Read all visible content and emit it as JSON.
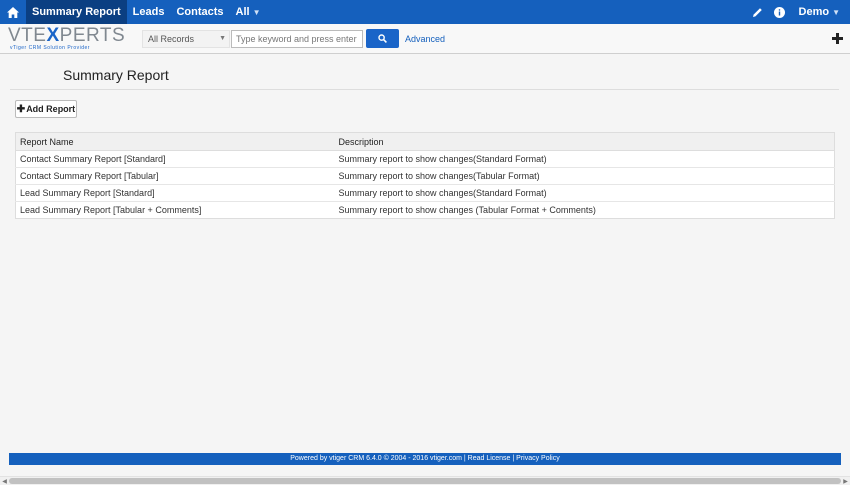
{
  "nav": {
    "items": [
      {
        "label": "Summary Report",
        "active": true
      },
      {
        "label": "Leads",
        "active": false
      },
      {
        "label": "Contacts",
        "active": false
      }
    ],
    "all_label": "All",
    "user_label": "Demo",
    "accent_color": "#1560bd"
  },
  "header": {
    "logo_main_a": "VTE",
    "logo_main_x": "X",
    "logo_main_b": "PERTS",
    "logo_sub": "vTiger CRM Solution Provider",
    "records_select": "All Records",
    "search_placeholder": "Type keyword and press enter",
    "advanced_label": "Advanced"
  },
  "page": {
    "title": "Summary Report",
    "add_report_label": "Add Report"
  },
  "table": {
    "columns": [
      "Report Name",
      "Description"
    ],
    "rows": [
      {
        "name": "Contact Summary Report [Standard]",
        "description": "Summary report to show changes(Standard Format)"
      },
      {
        "name": "Contact Summary Report [Tabular]",
        "description": "Summary report to show changes(Tabular Format)"
      },
      {
        "name": "Lead Summary Report [Standard]",
        "description": "Summary report to show changes(Standard Format)"
      },
      {
        "name": "Lead Summary Report [Tabular + Comments]",
        "description": "Summary report to show changes (Tabular Format + Comments)"
      }
    ]
  },
  "footer": {
    "text": "Powered by vtiger CRM 6.4.0  © 2004 - 2016  vtiger.com | Read License | Privacy Policy"
  }
}
